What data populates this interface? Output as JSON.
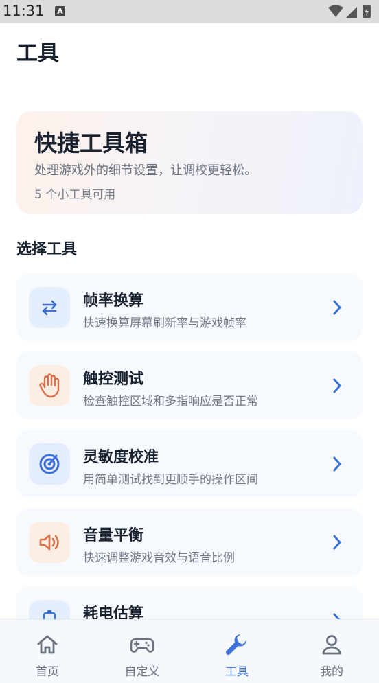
{
  "status_bar": {
    "time": "11:31",
    "notification_badge": "A"
  },
  "page": {
    "title": "工具"
  },
  "hero": {
    "title": "快捷工具箱",
    "subtitle": "处理游戏外的细节设置，让调校更轻松。",
    "count_text": "5 个小工具可用"
  },
  "section": {
    "title": "选择工具"
  },
  "tools": [
    {
      "name": "帧率换算",
      "desc": "快速换算屏幕刷新率与游戏帧率",
      "icon": "swap-arrows-icon",
      "tint": "blue"
    },
    {
      "name": "触控测试",
      "desc": "检查触控区域和多指响应是否正常",
      "icon": "hand-icon",
      "tint": "orange"
    },
    {
      "name": "灵敏度校准",
      "desc": "用简单测试找到更顺手的操作区间",
      "icon": "target-icon",
      "tint": "blue"
    },
    {
      "name": "音量平衡",
      "desc": "快速调整游戏音效与语音比例",
      "icon": "speaker-icon",
      "tint": "orange"
    },
    {
      "name": "耗电估算",
      "desc": "",
      "icon": "battery-icon",
      "tint": "blue"
    }
  ],
  "tabbar": {
    "items": [
      {
        "label": "首页",
        "icon": "home-icon"
      },
      {
        "label": "自定义",
        "icon": "gamepad-icon"
      },
      {
        "label": "工具",
        "icon": "wrench-icon",
        "active": true
      },
      {
        "label": "我的",
        "icon": "person-icon"
      }
    ]
  },
  "colors": {
    "accent": "#3d72d9",
    "icon_blue": "#3f6fd6",
    "icon_orange": "#d9704a"
  }
}
